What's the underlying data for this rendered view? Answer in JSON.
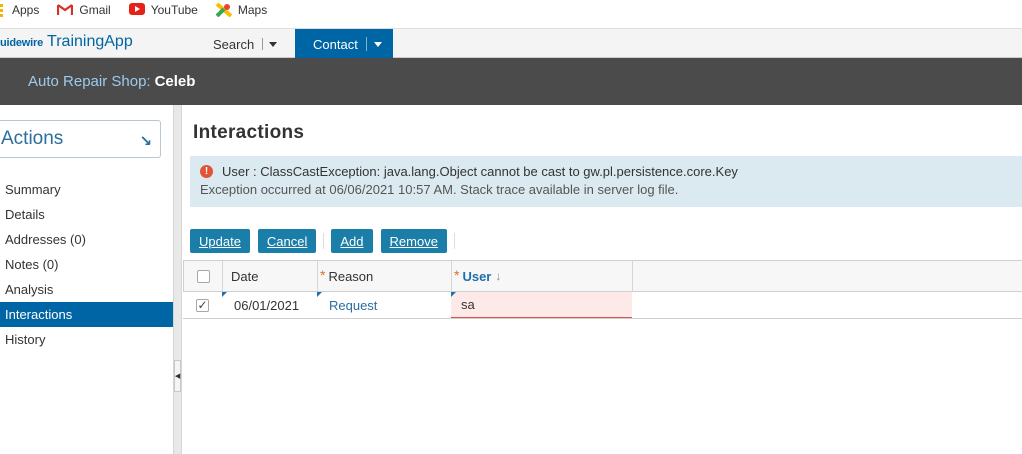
{
  "bookmarks": [
    {
      "label": "Apps",
      "icon": "apps-grid-icon"
    },
    {
      "label": "Gmail",
      "icon": "gmail-icon"
    },
    {
      "label": "YouTube",
      "icon": "youtube-icon"
    },
    {
      "label": "Maps",
      "icon": "maps-icon"
    }
  ],
  "header": {
    "brand_prefix": "uidewire",
    "brand_app": "TrainingApp",
    "tabs": [
      {
        "label": "Search"
      },
      {
        "label": "Contact"
      }
    ]
  },
  "infobar": {
    "label": "Auto Repair Shop:",
    "value": "Celeb"
  },
  "sidebar": {
    "actions_label": "Actions",
    "items": [
      {
        "label": "Summary"
      },
      {
        "label": "Details"
      },
      {
        "label": "Addresses (0)"
      },
      {
        "label": "Notes (0)"
      },
      {
        "label": "Analysis"
      },
      {
        "label": "Interactions"
      },
      {
        "label": "History"
      }
    ],
    "active_item": "Interactions"
  },
  "main": {
    "title": "Interactions",
    "alert": {
      "message": "User : ClassCastException: java.lang.Object cannot be cast to gw.pl.persistence.core.Key",
      "detail": "Exception occurred at 06/06/2021 10:57 AM. Stack trace available in server log file."
    },
    "toolbar": {
      "update": "Update",
      "cancel": "Cancel",
      "add": "Add",
      "remove": "Remove"
    },
    "grid": {
      "columns": [
        "Date",
        "Reason",
        "User"
      ],
      "rows": [
        {
          "date": "06/01/2021",
          "reason": "Request",
          "user": "sa",
          "checked": true
        }
      ]
    }
  },
  "colors": {
    "brand_blue": "#0065a4",
    "header_dark": "#4b4b4b",
    "alert_bg": "#dbe9f1",
    "button": "#1a7ea8",
    "required": "#e07020",
    "error": "#e0543a"
  }
}
